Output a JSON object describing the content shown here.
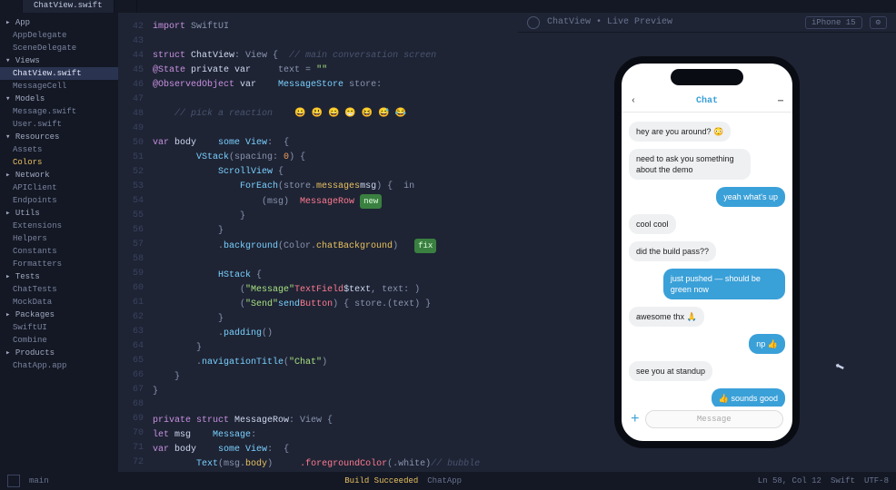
{
  "tabs": [
    {
      "label": ""
    },
    {
      "label": "ChatView.swift"
    },
    {
      "label": ""
    }
  ],
  "active_tab_index": 1,
  "sidebar": {
    "items": [
      {
        "label": "▸ App",
        "cls": "folder"
      },
      {
        "label": "AppDelegate",
        "cls": "i1"
      },
      {
        "label": "SceneDelegate",
        "cls": "i1"
      },
      {
        "label": "▾ Views",
        "cls": "folder"
      },
      {
        "label": "ChatView.swift",
        "cls": "i1 sel"
      },
      {
        "label": "MessageCell",
        "cls": "i1"
      },
      {
        "label": "▾ Models",
        "cls": "folder"
      },
      {
        "label": "Message.swift",
        "cls": "i1"
      },
      {
        "label": "User.swift",
        "cls": "i1"
      },
      {
        "label": "▾ Resources",
        "cls": "folder"
      },
      {
        "label": "Assets",
        "cls": "i1"
      },
      {
        "label": "Colors",
        "cls": "i1 hi"
      },
      {
        "label": "▸ Network",
        "cls": "folder"
      },
      {
        "label": "APIClient",
        "cls": "i1"
      },
      {
        "label": "Endpoints",
        "cls": "i1"
      },
      {
        "label": "▸ Utils",
        "cls": "folder"
      },
      {
        "label": "Extensions",
        "cls": "i1"
      },
      {
        "label": "Helpers",
        "cls": "i1"
      },
      {
        "label": "Constants",
        "cls": "i1"
      },
      {
        "label": "Formatters",
        "cls": "i1"
      },
      {
        "label": "▸ Tests",
        "cls": "folder"
      },
      {
        "label": "ChatTests",
        "cls": "i1"
      },
      {
        "label": "MockData",
        "cls": "i1"
      },
      {
        "label": "▸ Packages",
        "cls": "folder"
      },
      {
        "label": "SwiftUI",
        "cls": "i1"
      },
      {
        "label": "Combine",
        "cls": "i1"
      },
      {
        "label": "▸ Products",
        "cls": "folder"
      },
      {
        "label": "ChatApp.app",
        "cls": "i1"
      }
    ]
  },
  "editor": {
    "first_line": 42,
    "emoji_row": "😀 😃 😄 😁 😆 😅 😂",
    "lines": [
      {
        "t": "import",
        "r": " SwiftUI"
      },
      {
        "t": ""
      },
      {
        "kw": "struct",
        "id": " ChatView",
        "r": ": View {",
        "cm": "  // main conversation screen"
      },
      {
        "r": "    ",
        "kw": "@State",
        "id": " private var",
        "r2": " text = ",
        "str": "\"\""
      },
      {
        "r": "    ",
        "kw": "@ObservedObject",
        "id": " var",
        "r2": " store: ",
        "fn": "MessageStore"
      },
      {
        "r": ""
      },
      {
        "r": "    ",
        "cm": "// pick a reaction  ",
        "emoji": true
      },
      {
        "r": ""
      },
      {
        "r": "    ",
        "kw": "var",
        "id": " body",
        "r2": ": ",
        "fn": "some View",
        "r3": " {"
      },
      {
        "r": "        ",
        "fn": "VStack",
        "r2": "(spacing: ",
        "num": "0",
        "r3": ") {"
      },
      {
        "r": "            ",
        "fn": "ScrollView",
        "r2": " {"
      },
      {
        "r": "                ",
        "fn": "ForEach",
        "r2": "(store.",
        "prop": "messages",
        "r3": ") { ",
        "id2": "msg",
        "r4": " in"
      },
      {
        "r": "                    ",
        "tag": "MessageRow",
        "r2": "(msg)  ",
        "badge": "new"
      },
      {
        "r": "                }"
      },
      {
        "r": "            }"
      },
      {
        "r": "            .",
        "fn": "background",
        "r2": "(Color.",
        "prop": "chatBackground",
        "r3": ")  ",
        "badge": "fix"
      },
      {
        "r": ""
      },
      {
        "r": "            ",
        "fn": "HStack",
        "r2": " {"
      },
      {
        "r": "                ",
        "tag": "TextField",
        "r2": "(",
        "str": "\"Message\"",
        "r3": ", text: ",
        "id2": "$text",
        "r4": ")"
      },
      {
        "r": "                ",
        "tag": "Button",
        "r2": "(",
        "str": "\"Send\"",
        "r3": ") { store.",
        "fn2": "send",
        "r4": "(text) }"
      },
      {
        "r": "            }"
      },
      {
        "r": "            .",
        "fn": "padding",
        "r2": "()"
      },
      {
        "r": "        }"
      },
      {
        "r": "        .",
        "fn": "navigationTitle",
        "r2": "(",
        "str": "\"Chat\"",
        "r3": ")"
      },
      {
        "r": "    }"
      },
      {
        "r": "}"
      },
      {
        "r": ""
      },
      {
        "kw": "private struct",
        "id": " MessageRow",
        "r": ": View {"
      },
      {
        "r": "    ",
        "kw": "let",
        "id": " msg",
        "r2": ": ",
        "fn": "Message"
      },
      {
        "r": "    ",
        "kw": "var",
        "id": " body",
        "r2": ": ",
        "fn": "some View",
        "r3": " {"
      },
      {
        "r": "        ",
        "fn": "Text",
        "r2": "(msg.",
        "prop": "body",
        "r3": ")  ",
        "cm": "// bubble",
        "r4": "   ",
        "tag2": ".foregroundColor",
        "r5": "(.white)"
      }
    ]
  },
  "preview": {
    "url": "ChatView • Live Preview",
    "device": "iPhone 15"
  },
  "phone": {
    "back": "‹",
    "title": "Chat",
    "menu": "⋯",
    "input_placeholder": "Message",
    "plus": "+",
    "messages": [
      {
        "dir": "in",
        "text": "hey are you around? 😳"
      },
      {
        "dir": "in",
        "text": "need to ask you something about the demo"
      },
      {
        "dir": "out",
        "text": "yeah what's up"
      },
      {
        "dir": "in",
        "text": "cool cool"
      },
      {
        "dir": "in",
        "text": "did the build pass??"
      },
      {
        "dir": "out",
        "text": "just pushed — should be green now"
      },
      {
        "dir": "in",
        "text": "awesome thx 🙏"
      },
      {
        "dir": "out",
        "text": "np 👍"
      },
      {
        "dir": "in",
        "text": "see you at standup"
      },
      {
        "dir": "out",
        "text": "👍 sounds good"
      }
    ]
  },
  "statusbar": {
    "left1": "◧",
    "left2": "main",
    "mid1": "Build Succeeded",
    "mid2": "ChatApp",
    "right1": "Ln 58, Col 12",
    "right2": "Swift",
    "right3": "UTF-8"
  }
}
